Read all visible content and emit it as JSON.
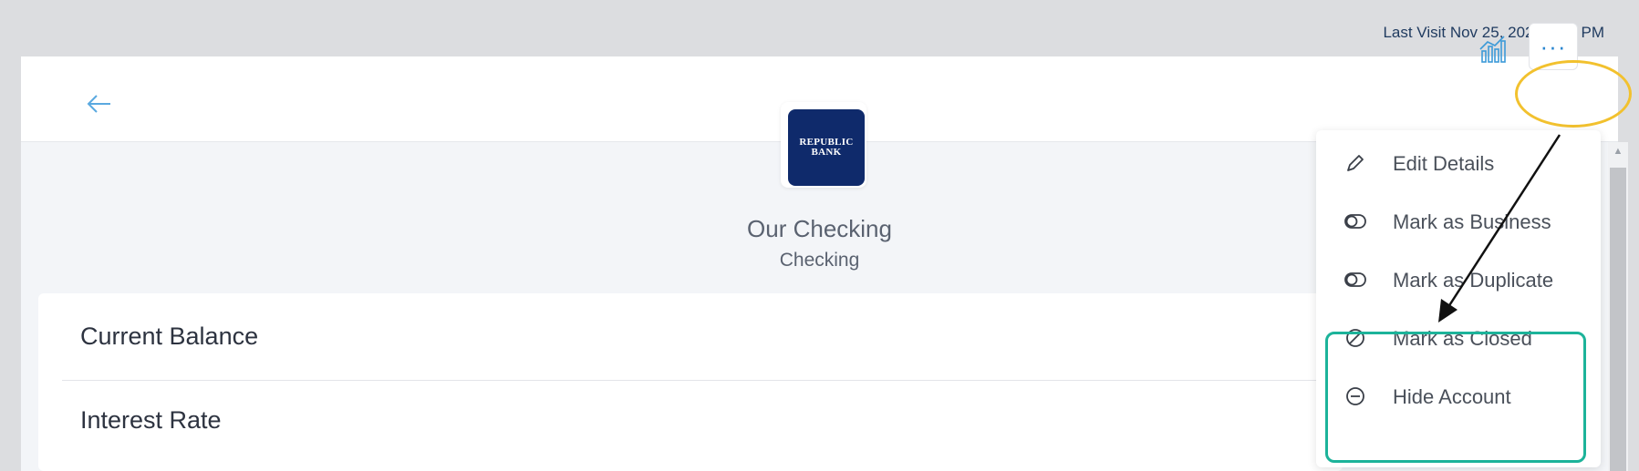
{
  "topbar": {
    "last_visit": "Last Visit Nov 25, 2024 1:21 PM"
  },
  "account": {
    "logo_line1": "REPUBLIC",
    "logo_line2": "BANK",
    "name": "Our Checking",
    "type": "Checking"
  },
  "details": {
    "rows": [
      {
        "label": "Current Balance"
      },
      {
        "label": "Interest Rate"
      }
    ]
  },
  "toolbar": {
    "back_icon": "arrow-left-icon",
    "analytics_icon": "bar-chart-icon",
    "more_label": "···"
  },
  "menu": {
    "items": [
      {
        "label": "Edit Details",
        "icon": "pencil-icon"
      },
      {
        "label": "Mark as Business",
        "icon": "toggle-icon"
      },
      {
        "label": "Mark as Duplicate",
        "icon": "toggle-icon"
      },
      {
        "label": "Mark as Closed",
        "icon": "ban-icon"
      },
      {
        "label": "Hide Account",
        "icon": "minus-circle-icon"
      }
    ]
  },
  "colors": {
    "accent": "#2a86d0",
    "highlight_yellow": "#f2c12e",
    "highlight_teal": "#1cb39a",
    "logo_bg": "#0f2a6b"
  }
}
